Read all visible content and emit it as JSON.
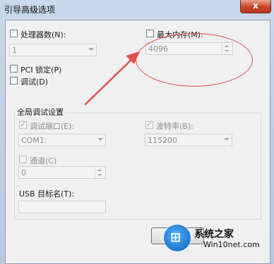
{
  "window": {
    "title": "引导高级选项",
    "close_label": "x"
  },
  "processors": {
    "label": "处理器数(N):",
    "value": "1",
    "checked": false
  },
  "max_memory": {
    "label": "最大内存(M):",
    "value": "4096",
    "checked": false
  },
  "pci_lock": {
    "label": "PCI 锁定(P)",
    "checked": false
  },
  "debug": {
    "label": "调试(D)",
    "checked": false
  },
  "global_debug": {
    "title": "全局调试设置",
    "debug_port_label": "调试端口(E):",
    "debug_port_value": "COM1:",
    "baud_rate_label": "波特率(B):",
    "baud_rate_value": "115200",
    "channel_label": "通道(C)",
    "channel_value": "0",
    "usb_target_label": "USB 目标名(T):",
    "usb_target_value": ""
  },
  "watermark": {
    "name": "系统之家",
    "url": "Win10net.com"
  },
  "colors": {
    "annotation": "#e05050",
    "title_bar": "#b7c9df",
    "close_button": "#c8442a"
  },
  "icons": {
    "annotation_arrow": "arrow-icon",
    "watermark_logo": "windows-logo-icon"
  }
}
